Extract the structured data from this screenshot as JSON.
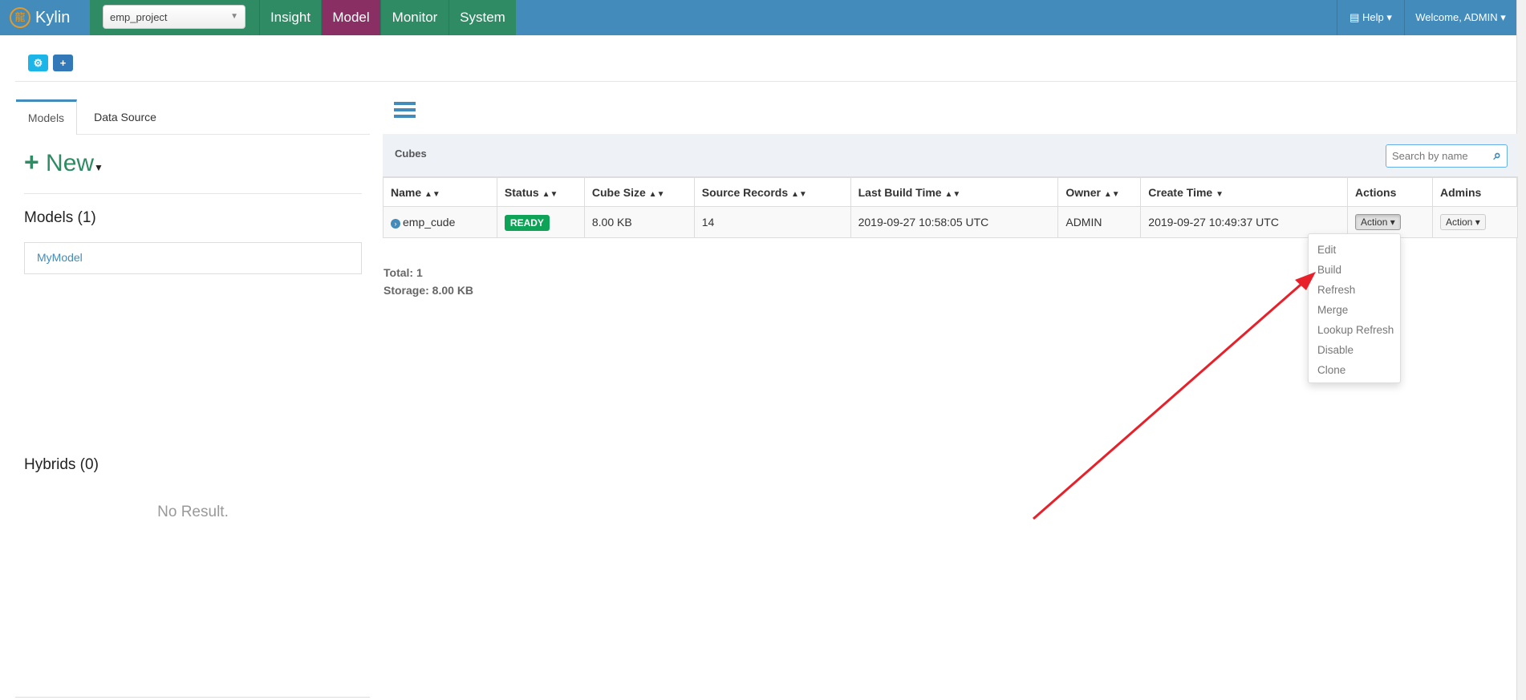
{
  "topbar": {
    "brand": "Kylin",
    "project": "emp_project",
    "nav": [
      "Insight",
      "Model",
      "Monitor",
      "System"
    ],
    "active_nav": "Model",
    "help": "Help",
    "welcome": "Welcome, ADMIN"
  },
  "toolbar": {
    "settings_icon": "gears-icon",
    "add_icon": "plus-icon"
  },
  "left": {
    "tabs": [
      "Models",
      "Data Source"
    ],
    "new_label": "New",
    "models_title": "Models (1)",
    "models": [
      "MyModel"
    ],
    "hybrids_title": "Hybrids (0)",
    "no_result": "No Result."
  },
  "cubes": {
    "title": "Cubes",
    "search_placeholder": "Search by name",
    "columns": [
      "Name",
      "Status",
      "Cube Size",
      "Source Records",
      "Last Build Time",
      "Owner",
      "Create Time",
      "Actions",
      "Admins"
    ],
    "rows": [
      {
        "name": "emp_cude",
        "status": "READY",
        "size": "8.00 KB",
        "records": "14",
        "last_build": "2019-09-27 10:58:05 UTC",
        "owner": "ADMIN",
        "create_time": "2019-09-27 10:49:37 UTC",
        "action": "Action",
        "admin_action": "Action"
      }
    ],
    "total": "Total: 1",
    "storage": "Storage: 8.00 KB"
  },
  "action_menu": [
    "Edit",
    "Build",
    "Refresh",
    "Merge",
    "Lookup Refresh",
    "Disable",
    "Clone"
  ],
  "colors": {
    "topbar": "#428bba",
    "nav": "#2e8b64",
    "nav_active": "#892f63",
    "ready": "#0ea356",
    "arrow": "#e8202a"
  }
}
